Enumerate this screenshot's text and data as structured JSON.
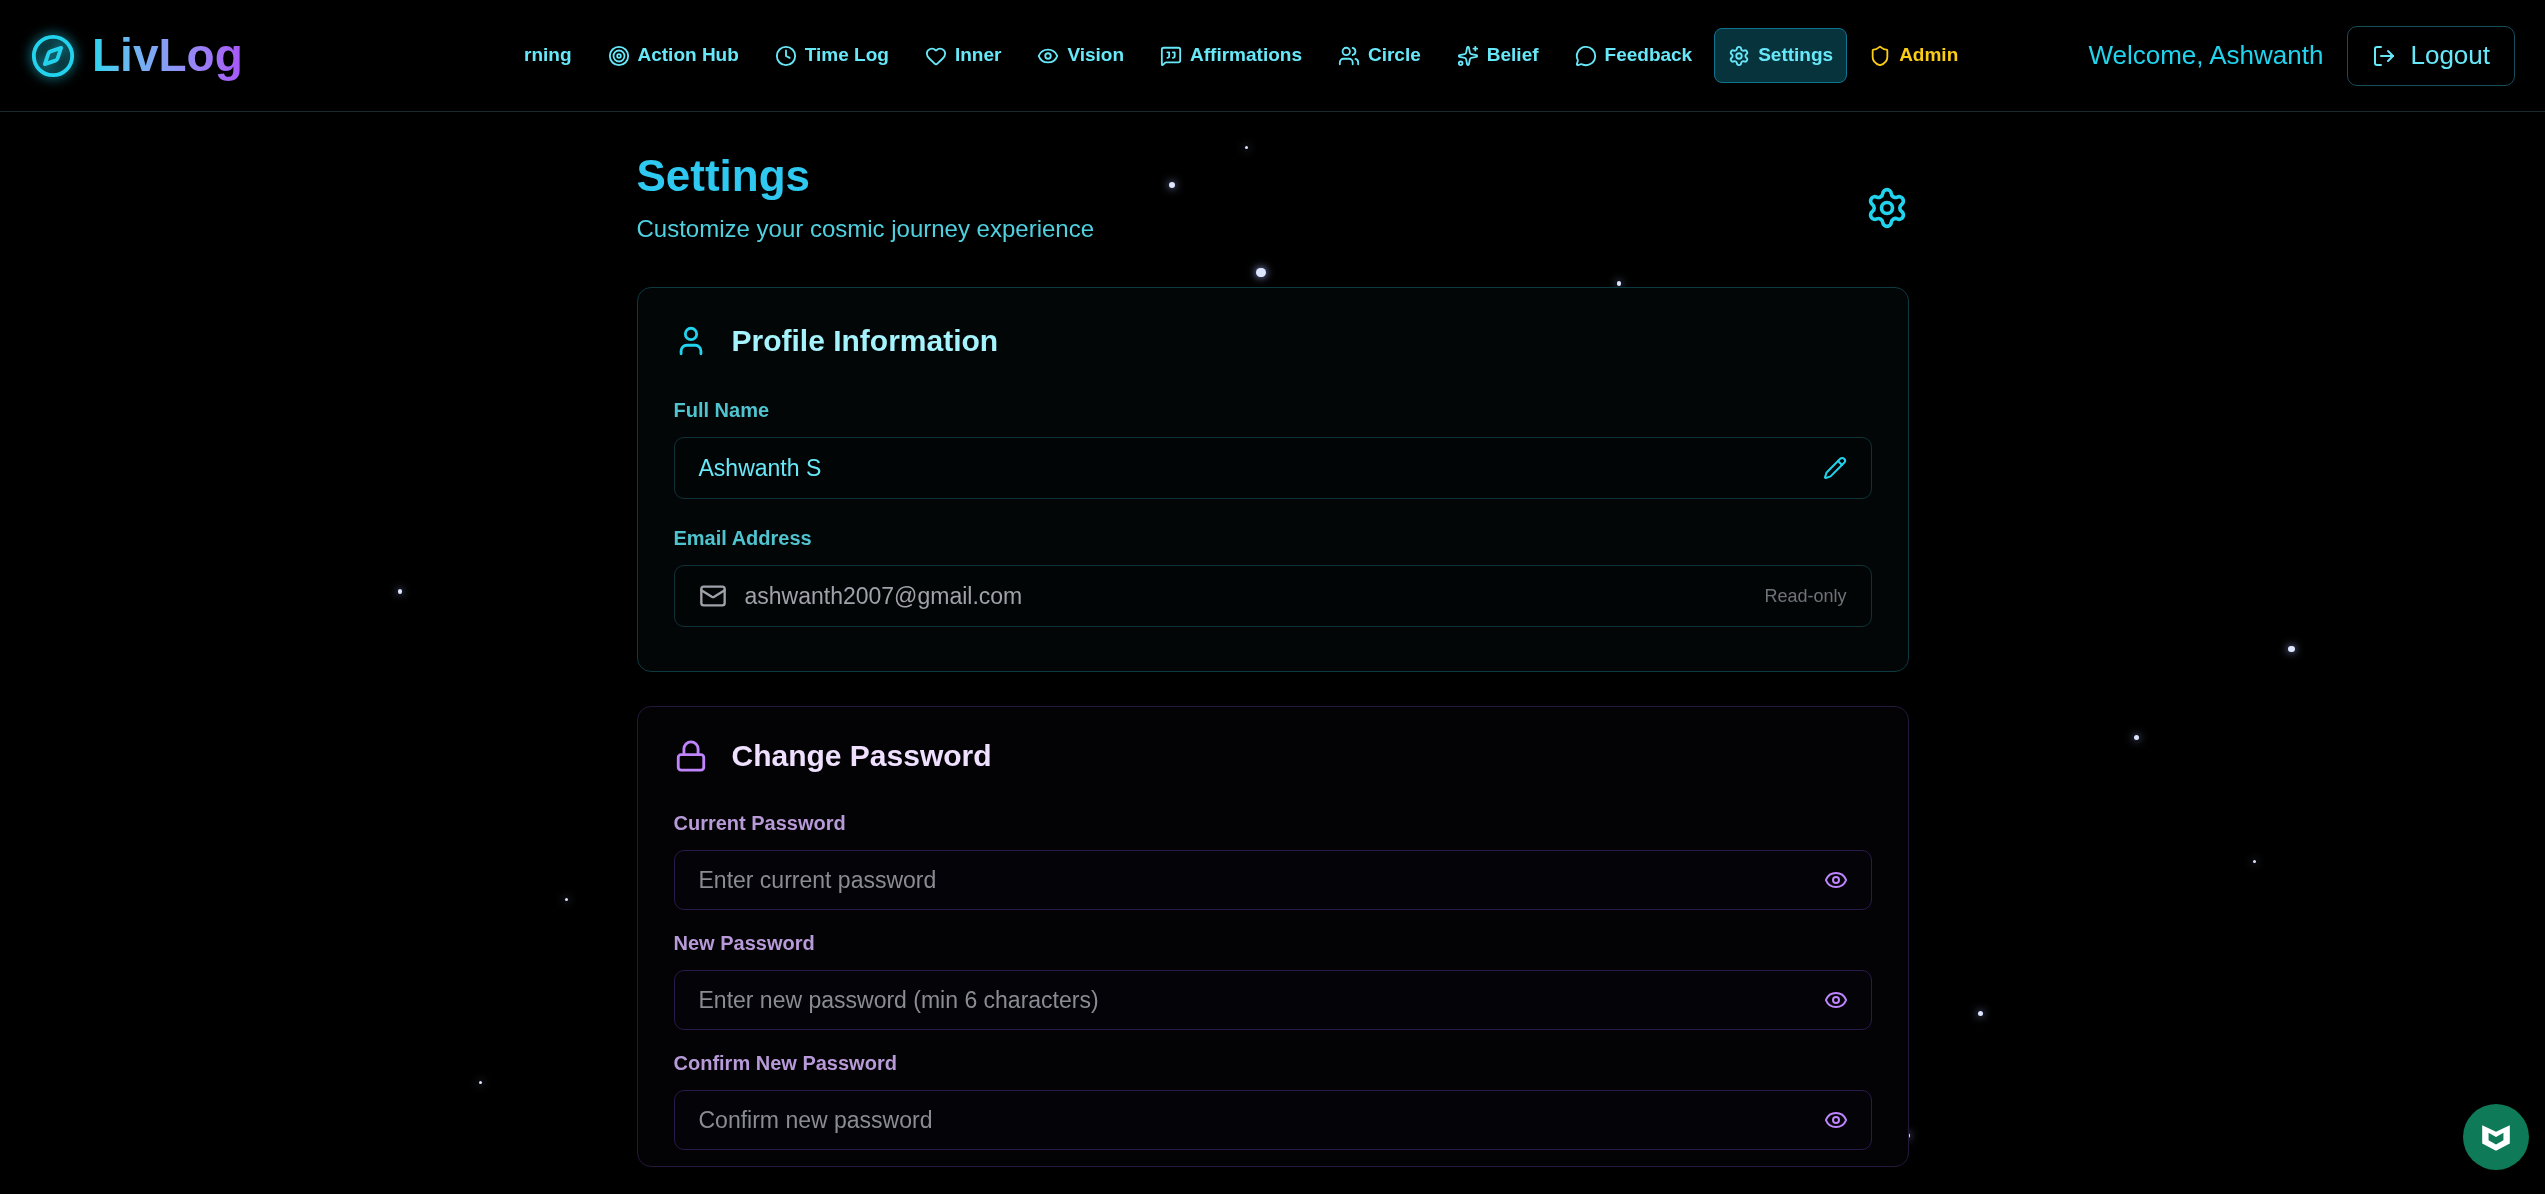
{
  "header": {
    "logo": "LivLog",
    "nav": [
      {
        "label": "rning",
        "selected": false,
        "kind": "cut"
      },
      {
        "label": "Action Hub",
        "selected": false,
        "kind": "normal"
      },
      {
        "label": "Time Log",
        "selected": false,
        "kind": "normal"
      },
      {
        "label": "Inner",
        "selected": false,
        "kind": "normal"
      },
      {
        "label": "Vision",
        "selected": false,
        "kind": "normal"
      },
      {
        "label": "Affirmations",
        "selected": false,
        "kind": "normal"
      },
      {
        "label": "Circle",
        "selected": false,
        "kind": "normal"
      },
      {
        "label": "Belief",
        "selected": false,
        "kind": "normal"
      },
      {
        "label": "Feedback",
        "selected": false,
        "kind": "normal"
      },
      {
        "label": "Settings",
        "selected": true,
        "kind": "normal"
      },
      {
        "label": "Admin",
        "selected": false,
        "kind": "admin"
      }
    ],
    "welcome": "Welcome, Ashwanth",
    "logout": "Logout"
  },
  "page": {
    "title": "Settings",
    "subtitle": "Customize your cosmic journey experience"
  },
  "profile": {
    "title": "Profile Information",
    "fields": [
      {
        "label": "Full Name",
        "value": "Ashwanth S",
        "kind": "editable"
      },
      {
        "label": "Email Address",
        "value": "ashwanth2007@gmail.com",
        "kind": "readonly",
        "note": "Read-only"
      }
    ]
  },
  "password": {
    "title": "Change Password",
    "fields": [
      {
        "label": "Current Password",
        "placeholder": "Enter current password"
      },
      {
        "label": "New Password",
        "placeholder": "Enter new password (min 6 characters)"
      },
      {
        "label": "Confirm New Password",
        "placeholder": "Confirm new password"
      }
    ]
  }
}
